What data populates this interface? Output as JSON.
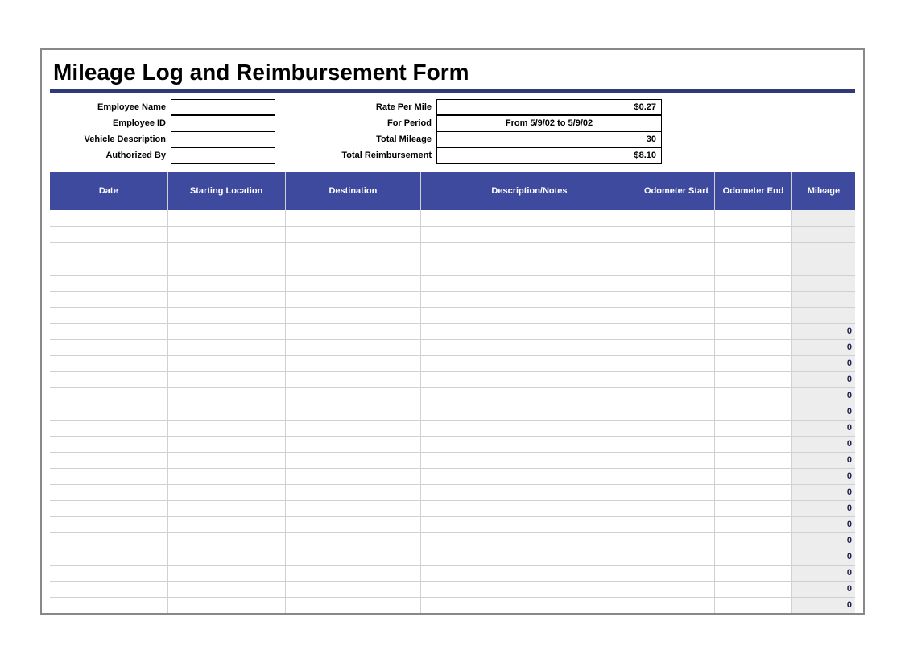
{
  "title": "Mileage Log and Reimbursement Form",
  "meta": {
    "employee_name_label": "Employee Name",
    "employee_name_value": "",
    "employee_id_label": "Employee ID",
    "employee_id_value": "",
    "vehicle_desc_label": "Vehicle Description",
    "vehicle_desc_value": "",
    "authorized_by_label": "Authorized By",
    "authorized_by_value": "",
    "rate_label": "Rate Per Mile",
    "rate_value": "$0.27",
    "period_label": "For Period",
    "period_value": "From 5/9/02 to 5/9/02",
    "total_mileage_label": "Total Mileage",
    "total_mileage_value": "30",
    "total_reimb_label": "Total Reimbursement",
    "total_reimb_value": "$8.10"
  },
  "columns": {
    "date": "Date",
    "start": "Starting Location",
    "dest": "Destination",
    "desc": "Description/Notes",
    "ostart": "Odometer Start",
    "oend": "Odometer End",
    "mileage": "Mileage"
  },
  "rows": [
    {
      "date": "",
      "start": "",
      "dest": "",
      "desc": "",
      "ostart": "",
      "oend": "",
      "mileage": ""
    },
    {
      "date": "",
      "start": "",
      "dest": "",
      "desc": "",
      "ostart": "",
      "oend": "",
      "mileage": ""
    },
    {
      "date": "",
      "start": "",
      "dest": "",
      "desc": "",
      "ostart": "",
      "oend": "",
      "mileage": ""
    },
    {
      "date": "",
      "start": "",
      "dest": "",
      "desc": "",
      "ostart": "",
      "oend": "",
      "mileage": ""
    },
    {
      "date": "",
      "start": "",
      "dest": "",
      "desc": "",
      "ostart": "",
      "oend": "",
      "mileage": ""
    },
    {
      "date": "",
      "start": "",
      "dest": "",
      "desc": "",
      "ostart": "",
      "oend": "",
      "mileage": ""
    },
    {
      "date": "",
      "start": "",
      "dest": "",
      "desc": "",
      "ostart": "",
      "oend": "",
      "mileage": ""
    },
    {
      "date": "",
      "start": "",
      "dest": "",
      "desc": "",
      "ostart": "",
      "oend": "",
      "mileage": "0"
    },
    {
      "date": "",
      "start": "",
      "dest": "",
      "desc": "",
      "ostart": "",
      "oend": "",
      "mileage": "0"
    },
    {
      "date": "",
      "start": "",
      "dest": "",
      "desc": "",
      "ostart": "",
      "oend": "",
      "mileage": "0"
    },
    {
      "date": "",
      "start": "",
      "dest": "",
      "desc": "",
      "ostart": "",
      "oend": "",
      "mileage": "0"
    },
    {
      "date": "",
      "start": "",
      "dest": "",
      "desc": "",
      "ostart": "",
      "oend": "",
      "mileage": "0"
    },
    {
      "date": "",
      "start": "",
      "dest": "",
      "desc": "",
      "ostart": "",
      "oend": "",
      "mileage": "0"
    },
    {
      "date": "",
      "start": "",
      "dest": "",
      "desc": "",
      "ostart": "",
      "oend": "",
      "mileage": "0"
    },
    {
      "date": "",
      "start": "",
      "dest": "",
      "desc": "",
      "ostart": "",
      "oend": "",
      "mileage": "0"
    },
    {
      "date": "",
      "start": "",
      "dest": "",
      "desc": "",
      "ostart": "",
      "oend": "",
      "mileage": "0"
    },
    {
      "date": "",
      "start": "",
      "dest": "",
      "desc": "",
      "ostart": "",
      "oend": "",
      "mileage": "0"
    },
    {
      "date": "",
      "start": "",
      "dest": "",
      "desc": "",
      "ostart": "",
      "oend": "",
      "mileage": "0"
    },
    {
      "date": "",
      "start": "",
      "dest": "",
      "desc": "",
      "ostart": "",
      "oend": "",
      "mileage": "0"
    },
    {
      "date": "",
      "start": "",
      "dest": "",
      "desc": "",
      "ostart": "",
      "oend": "",
      "mileage": "0"
    },
    {
      "date": "",
      "start": "",
      "dest": "",
      "desc": "",
      "ostart": "",
      "oend": "",
      "mileage": "0"
    },
    {
      "date": "",
      "start": "",
      "dest": "",
      "desc": "",
      "ostart": "",
      "oend": "",
      "mileage": "0"
    },
    {
      "date": "",
      "start": "",
      "dest": "",
      "desc": "",
      "ostart": "",
      "oend": "",
      "mileage": "0"
    },
    {
      "date": "",
      "start": "",
      "dest": "",
      "desc": "",
      "ostart": "",
      "oend": "",
      "mileage": "0"
    },
    {
      "date": "",
      "start": "",
      "dest": "",
      "desc": "",
      "ostart": "",
      "oend": "",
      "mileage": "0"
    }
  ]
}
